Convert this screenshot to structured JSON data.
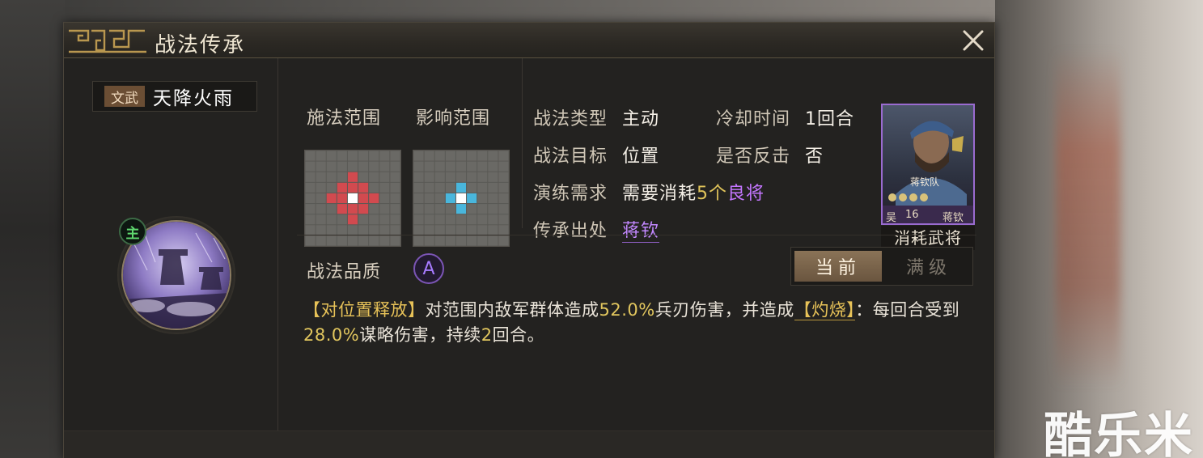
{
  "window": {
    "title": "战法传承"
  },
  "skill": {
    "tag": "文武",
    "name": "天降火雨",
    "main_badge": "主"
  },
  "ranges": {
    "cast_label": "施法范围",
    "effect_label": "影响范围"
  },
  "info": {
    "type_label": "战法类型",
    "type_value": "主动",
    "cooldown_label": "冷却时间",
    "cooldown_value": "1回合",
    "target_label": "战法目标",
    "target_value": "位置",
    "counter_label": "是否反击",
    "counter_value": "否",
    "practice_label": "演练需求",
    "practice_prefix": "需要消耗",
    "practice_count": "5个",
    "practice_item": "良将",
    "source_label": "传承出处",
    "source_value": "蒋钦"
  },
  "hero_card": {
    "faction_mark": "吴",
    "unit_name": "蒋钦队",
    "level": "16",
    "name": "蒋钦",
    "caption": "消耗武将"
  },
  "quality": {
    "label": "战法品质",
    "grade": "A"
  },
  "tabs": {
    "current": "当前",
    "max": "满级"
  },
  "description": {
    "tag1": "【对位置释放】",
    "part1": "对范围内敌军群体造成",
    "dmg1": "52.0%",
    "part2": "兵刃伤害，并造成",
    "tag2": "【灼烧】",
    "part3": "：每回合受到",
    "dmg2": "28.0%",
    "part4": "谋略伤害，持续",
    "turns": "2",
    "part5": "回合。"
  },
  "watermark": "酷乐米",
  "colors": {
    "panel_bg": "#232220",
    "accent_gold": "#e0c45a",
    "accent_purple": "#c476ff",
    "cast_cell": "#d24a4f",
    "effect_cell": "#49b6dc"
  }
}
